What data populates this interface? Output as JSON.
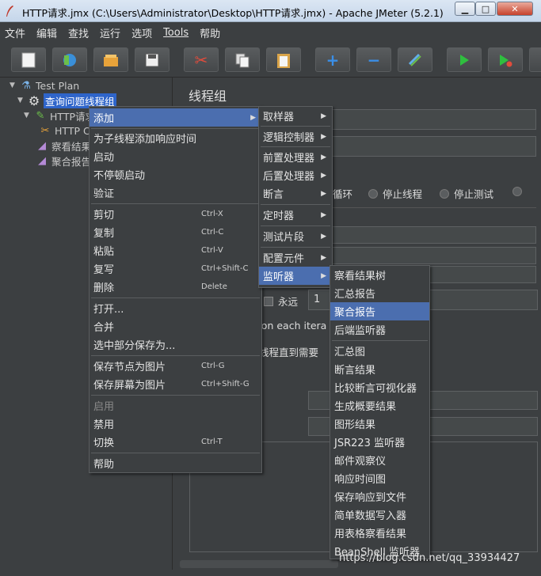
{
  "window": {
    "title": "HTTP请求.jmx (C:\\Users\\Administrator\\Desktop\\HTTP请求.jmx) - Apache JMeter (5.2.1)"
  },
  "menubar": [
    "文件",
    "编辑",
    "查找",
    "运行",
    "选项",
    "Tools",
    "帮助"
  ],
  "toolbar": {
    "icons": [
      "new-icon",
      "templates-icon",
      "open-icon",
      "save-icon",
      "cut-icon",
      "copy-icon",
      "paste-icon",
      "expand-icon",
      "collapse-icon",
      "toggle-icon",
      "start-icon",
      "start-no-pause-icon"
    ],
    "glyphs": {
      "expand": "+",
      "collapse": "−"
    }
  },
  "tree": {
    "test_plan": "Test Plan",
    "thread_group": "查询问题线程组",
    "http_request": "HTTP请求",
    "http_sub": "HTTP C",
    "view_results": "察看结果",
    "aggregate": "聚合报告"
  },
  "right_panel": {
    "title": "线程组",
    "loop": "循环",
    "stop_thread": "停止线程",
    "stop_test": "停止测试",
    "forever": "永远",
    "loop_value": "1",
    "same_user": "er on each itera",
    "delay_thread": "线程直到需要"
  },
  "context_menu": {
    "items": [
      {
        "label": "添加",
        "shortcut": "",
        "submenu": true
      },
      {
        "label": "为子线程添加响应时间",
        "shortcut": ""
      },
      {
        "label": "启动",
        "shortcut": ""
      },
      {
        "label": "不停顿启动",
        "shortcut": ""
      },
      {
        "label": "验证",
        "shortcut": ""
      },
      {
        "label": "剪切",
        "shortcut": "Ctrl-X"
      },
      {
        "label": "复制",
        "shortcut": "Ctrl-C"
      },
      {
        "label": "粘贴",
        "shortcut": "Ctrl-V"
      },
      {
        "label": "复写",
        "shortcut": "Ctrl+Shift-C"
      },
      {
        "label": "删除",
        "shortcut": "Delete"
      },
      {
        "label": "打开...",
        "shortcut": ""
      },
      {
        "label": "合并",
        "shortcut": ""
      },
      {
        "label": "选中部分保存为...",
        "shortcut": ""
      },
      {
        "label": "保存节点为图片",
        "shortcut": "Ctrl-G"
      },
      {
        "label": "保存屏幕为图片",
        "shortcut": "Ctrl+Shift-G"
      },
      {
        "label": "启用",
        "shortcut": ""
      },
      {
        "label": "禁用",
        "shortcut": ""
      },
      {
        "label": "切换",
        "shortcut": "Ctrl-T"
      },
      {
        "label": "帮助",
        "shortcut": ""
      }
    ]
  },
  "add_submenu": {
    "items": [
      "取样器",
      "逻辑控制器",
      "前置处理器",
      "后置处理器",
      "断言",
      "定时器",
      "测试片段",
      "配置元件",
      "监听器"
    ]
  },
  "listener_submenu": {
    "items": [
      "察看结果树",
      "汇总报告",
      "聚合报告",
      "后端监听器",
      "汇总图",
      "断言结果",
      "比较断言可视化器",
      "生成概要结果",
      "图形结果",
      "JSR223 监听器",
      "邮件观察仪",
      "响应时间图",
      "保存响应到文件",
      "简单数据写入器",
      "用表格察看结果",
      "BeanShell 监听器"
    ]
  },
  "watermark": "https://blog.csdn.net/qq_33934427"
}
